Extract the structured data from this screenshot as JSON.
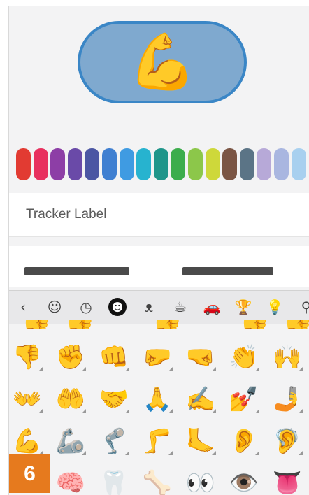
{
  "tracker_icon": {
    "emoji": "💪",
    "name": "flexed-biceps"
  },
  "colors": [
    "#e23b32",
    "#e8305e",
    "#8d3ea6",
    "#6a4aa8",
    "#4b56a3",
    "#3f7fd1",
    "#3f9be2",
    "#27b3cf",
    "#1f958a",
    "#3cad4c",
    "#8cc74a",
    "#ced83a",
    "#7b5544",
    "#5b7486",
    "#b7a9d8",
    "#a9b6e0",
    "#a8d0ef"
  ],
  "label_field": {
    "text": "Tracker Label"
  },
  "keyboard": {
    "tabs": [
      {
        "name": "back-icon",
        "glyph": "‹"
      },
      {
        "name": "sticker-icon",
        "glyph": "☺"
      },
      {
        "name": "recent-clock-icon",
        "glyph": "◷"
      },
      {
        "name": "smileys-icon",
        "glyph": "☻",
        "active": true
      },
      {
        "name": "animals-icon",
        "glyph": "ᴥ"
      },
      {
        "name": "food-drink-icon",
        "glyph": "☕"
      },
      {
        "name": "travel-car-icon",
        "glyph": "🚗"
      },
      {
        "name": "activities-trophy-icon",
        "glyph": "🏆"
      },
      {
        "name": "objects-bulb-icon",
        "glyph": "💡"
      },
      {
        "name": "symbols-icon",
        "glyph": "⚲"
      }
    ],
    "emoji_rows": [
      [
        "👎",
        "✊",
        "👊",
        "🤛",
        "🤜",
        "👏",
        "🙌"
      ],
      [
        "👐",
        "🤲",
        "🤝",
        "🙏",
        "✍️",
        "💅",
        "🤳"
      ],
      [
        "💪",
        "🦾",
        "🦿",
        "🦵",
        "🦶",
        "👂",
        "🦻"
      ],
      [
        "",
        "🧠",
        "🦷",
        "🦴",
        "👀",
        "👁️",
        "👅"
      ]
    ]
  },
  "step_badge": {
    "number": "6"
  }
}
